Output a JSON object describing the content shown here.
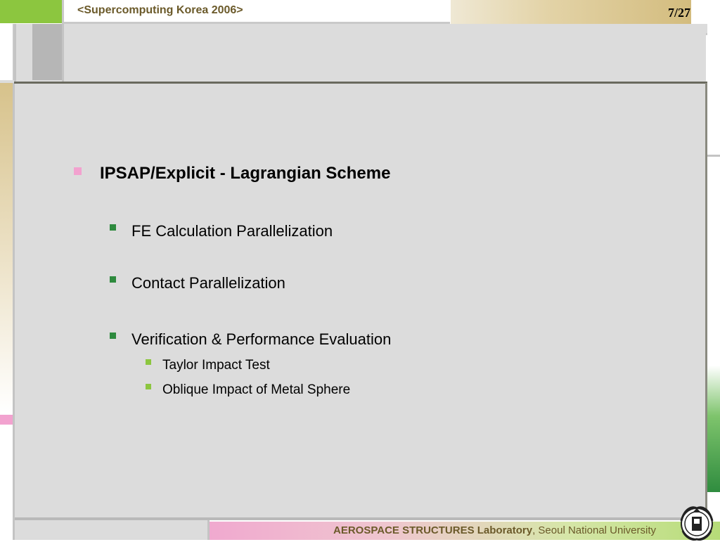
{
  "header": {
    "title": "<Supercomputing Korea 2006>",
    "page": "7/27"
  },
  "bullets": [
    {
      "level": 1,
      "text": "IPSAP/Explicit - Lagrangian Scheme",
      "marker_color": "#f2a2cf"
    },
    {
      "level": 2,
      "text": "FE Calculation Parallelization",
      "marker_color": "#2e8a3e"
    },
    {
      "level": 2,
      "text": "Contact Parallelization",
      "marker_color": "#2e8a3e"
    },
    {
      "level": 2,
      "text": "Verification & Performance Evaluation",
      "marker_color": "#2e8a3e"
    },
    {
      "level": 3,
      "text": "Taylor Impact Test",
      "marker_color": "#8cc63f"
    },
    {
      "level": 3,
      "text": "Oblique Impact of Metal Sphere",
      "marker_color": "#8cc63f"
    }
  ],
  "footer": {
    "lab": "AEROSPACE STRUCTURES Laboratory",
    "university": ", Seoul National University"
  },
  "colors": {
    "accent_green": "#8cc63f",
    "accent_gold": "#d3bc7e",
    "accent_pink": "#f2a2cf",
    "background": "#dcdcdc"
  },
  "logo": {
    "icon": "university-seal-icon"
  }
}
